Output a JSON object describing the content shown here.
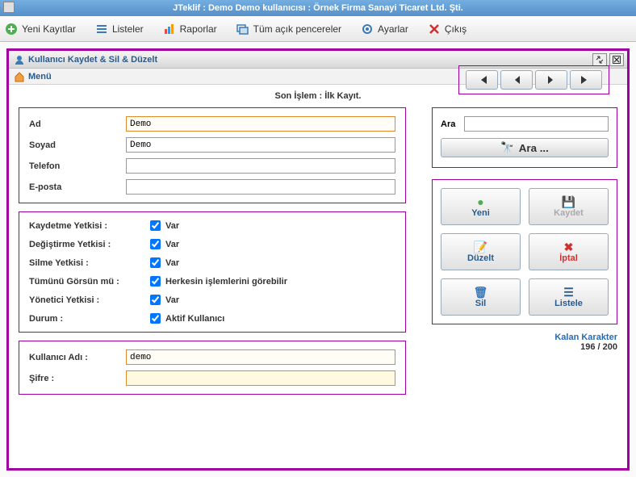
{
  "title": "JTeklif : Demo Demo kullanıcısı : Örnek Firma Sanayi Ticaret Ltd. Şti.",
  "menubar": {
    "yeni": "Yeni Kayıtlar",
    "listeler": "Listeler",
    "raporlar": "Raporlar",
    "pencereler": "Tüm açık pencereler",
    "ayarlar": "Ayarlar",
    "cikis": "Çıkış"
  },
  "panel": {
    "title": "Kullanıcı Kaydet & Sil & Düzelt",
    "menu": "Menü"
  },
  "status": "Son İşlem : İlk Kayıt.",
  "form": {
    "ad_label": "Ad",
    "ad_value": "Demo",
    "soyad_label": "Soyad",
    "soyad_value": "Demo",
    "telefon_label": "Telefon",
    "telefon_value": "",
    "eposta_label": "E-posta",
    "eposta_value": ""
  },
  "auth": {
    "kaydetme_label": "Kaydetme Yetkisi :",
    "kaydetme_val": "Var",
    "degistirme_label": "Değiştirme Yetkisi :",
    "degistirme_val": "Var",
    "silme_label": "Silme Yetkisi :",
    "silme_val": "Var",
    "tumunu_label": "Tümünü Görsün mü :",
    "tumunu_val": "Herkesin işlemlerini görebilir",
    "yonetici_label": "Yönetici Yetkisi :",
    "yonetici_val": "Var",
    "durum_label": "Durum :",
    "durum_val": "Aktif Kullanıcı"
  },
  "cred": {
    "user_label": "Kullanıcı Adı :",
    "user_value": "demo",
    "pass_label": "Şifre :",
    "pass_value": ""
  },
  "search": {
    "label": "Ara",
    "button": "Ara ..."
  },
  "actions": {
    "yeni": "Yeni",
    "kaydet": "Kaydet",
    "duzelt": "Düzelt",
    "iptal": "İptal",
    "sil": "Sil",
    "listele": "Listele"
  },
  "remaining": {
    "title": "Kalan Karakter",
    "count": "196 / 200"
  }
}
